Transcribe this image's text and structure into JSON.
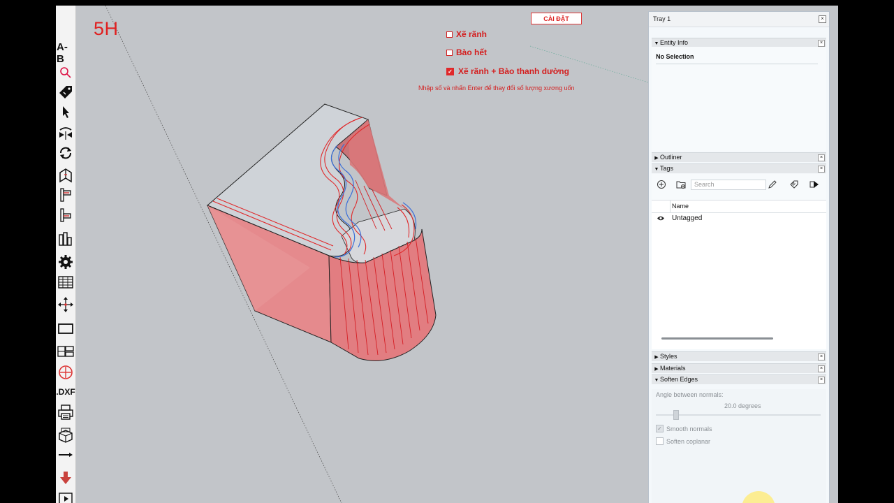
{
  "toolbar": {
    "label_ab": "A-B",
    "label_dxf": ".DXF",
    "icons": [
      "search-icon",
      "tag-icon",
      "select-arrow-icon",
      "flip-icon",
      "rotate-icon",
      "fold-icon",
      "align-top-icon",
      "align-left-icon",
      "bars-icon",
      "gear-icon",
      "table-grid-icon",
      "move-arrows-icon",
      "rectangle-icon",
      "layout-icon",
      "target-icon",
      "print-icon",
      "box-3d-icon",
      "line-arrow-icon",
      "down-arrow-icon",
      "play-icon"
    ]
  },
  "viewport": {
    "brand": "5H",
    "settings_button": "CÀI ĐẶT",
    "options": [
      {
        "label": "Xẽ rãnh",
        "checked": false
      },
      {
        "label": "Bào hết",
        "checked": false
      },
      {
        "label": "Xẽ rãnh + Bào thanh dường",
        "checked": true
      }
    ],
    "hint": "Nhập số và nhấn Enter để thay đổi số lượng xương uốn"
  },
  "tray": {
    "title": "Tray 1",
    "entity_info": {
      "title": "Entity Info",
      "selection": "No Selection"
    },
    "outliner": {
      "title": "Outliner"
    },
    "tags": {
      "title": "Tags",
      "search_placeholder": "Search",
      "column_name": "Name",
      "rows": [
        "Untagged"
      ]
    },
    "styles": {
      "title": "Styles"
    },
    "materials": {
      "title": "Materials"
    },
    "soften_edges": {
      "title": "Soften Edges",
      "angle_label": "Angle between normals:",
      "angle_value": "20.0  degrees",
      "smooth_normals": "Smooth normals",
      "soften_coplanar": "Soften coplanar",
      "smooth_checked": true,
      "coplanar_checked": false
    }
  },
  "colors": {
    "accent_red": "#e0282a",
    "model_fill": "#e78b8b",
    "viewport_bg": "#c2c5c9",
    "blue_line": "#3b6fd8"
  }
}
